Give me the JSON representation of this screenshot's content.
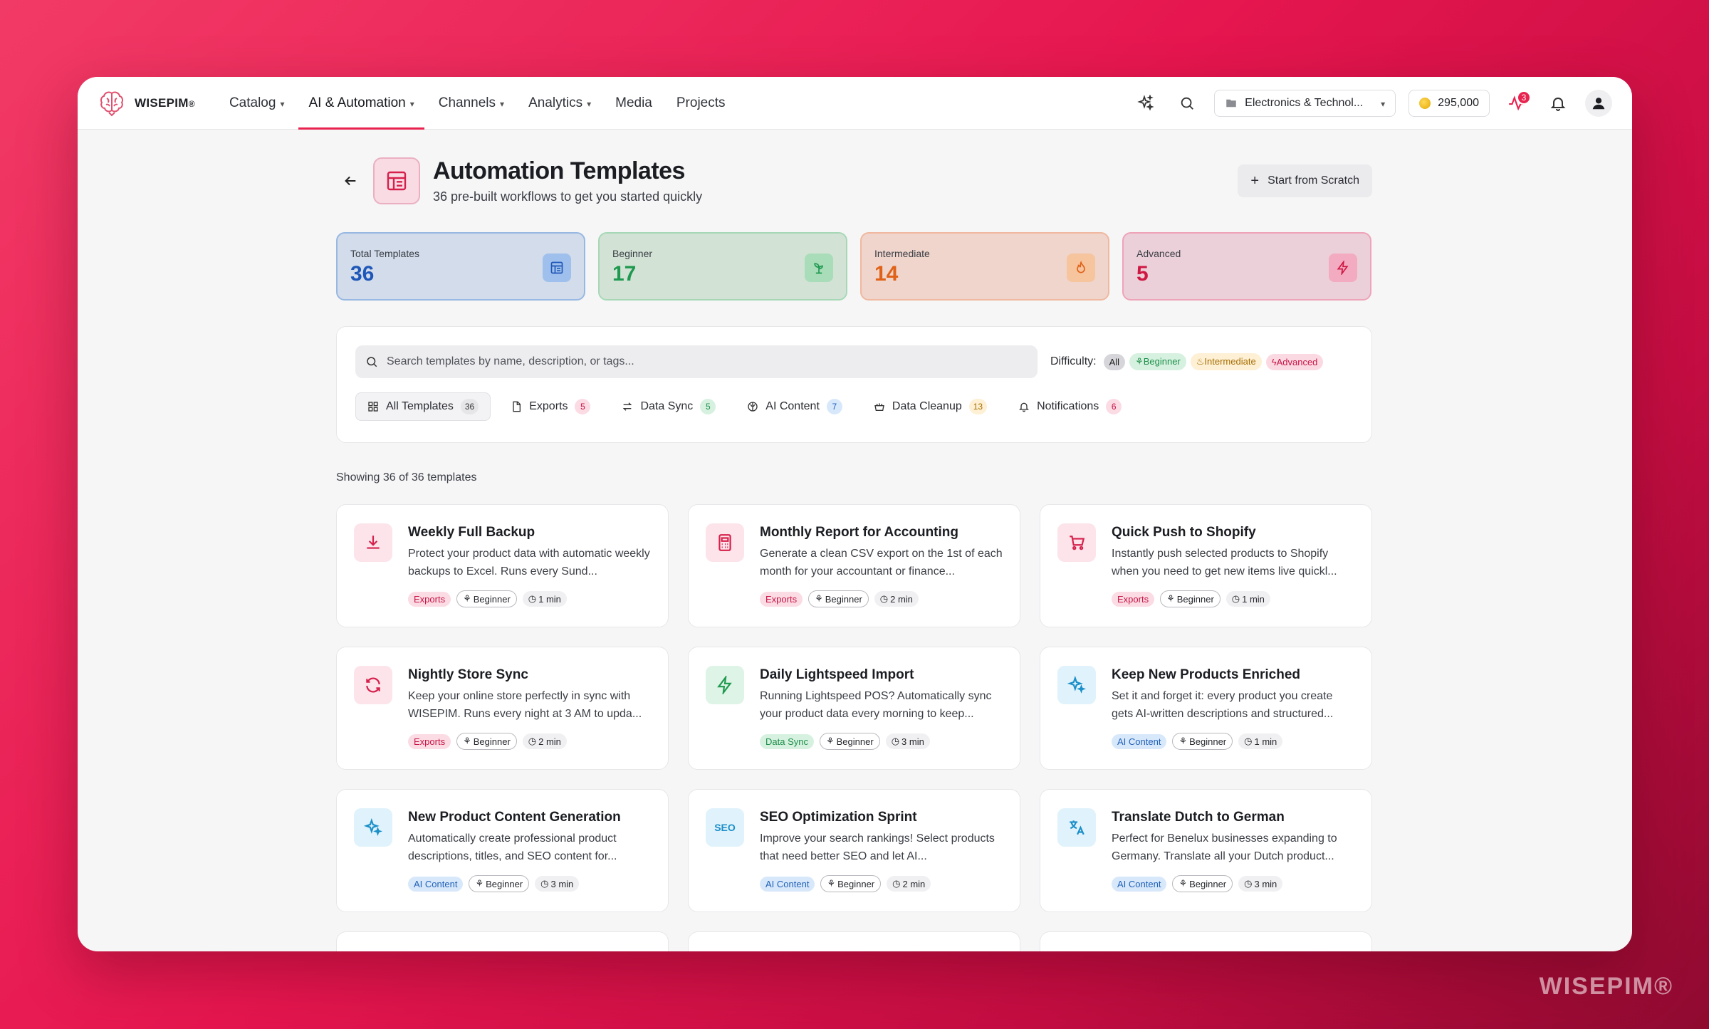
{
  "brand": {
    "name": "WISEPIM",
    "reg": "®",
    "watermark": "WISEPIM®"
  },
  "nav": [
    {
      "label": "Catalog",
      "dropdown": true,
      "active": false
    },
    {
      "label": "AI & Automation",
      "dropdown": true,
      "active": true
    },
    {
      "label": "Channels",
      "dropdown": true,
      "active": false
    },
    {
      "label": "Analytics",
      "dropdown": true,
      "active": false
    },
    {
      "label": "Media",
      "dropdown": false,
      "active": false
    },
    {
      "label": "Projects",
      "dropdown": false,
      "active": false
    }
  ],
  "topbar": {
    "workspace": "Electronics & Technol...",
    "credits": "295,000",
    "activity_badge": "3"
  },
  "page": {
    "title": "Automation Templates",
    "subtitle": "36 pre-built workflows to get you started quickly",
    "scratch_button": "Start from Scratch"
  },
  "stats": [
    {
      "label": "Total Templates",
      "value": "36",
      "icon": "template-icon"
    },
    {
      "label": "Beginner",
      "value": "17",
      "icon": "sprout-icon"
    },
    {
      "label": "Intermediate",
      "value": "14",
      "icon": "flame-icon"
    },
    {
      "label": "Advanced",
      "value": "5",
      "icon": "bolt-icon"
    }
  ],
  "filters": {
    "search_placeholder": "Search templates by name, description, or tags...",
    "difficulty_label": "Difficulty:",
    "difficulty_options": [
      "All",
      "Beginner",
      "Intermediate",
      "Advanced"
    ],
    "difficulty_selected": "All",
    "tabs": [
      {
        "label": "All Templates",
        "count": "36",
        "icon": "grid-icon"
      },
      {
        "label": "Exports",
        "count": "5",
        "icon": "file-icon"
      },
      {
        "label": "Data Sync",
        "count": "5",
        "icon": "arrows-icon"
      },
      {
        "label": "AI Content",
        "count": "7",
        "icon": "brain-icon"
      },
      {
        "label": "Data Cleanup",
        "count": "13",
        "icon": "brush-icon"
      },
      {
        "label": "Notifications",
        "count": "6",
        "icon": "bell-icon"
      }
    ]
  },
  "showing_text": "Showing 36 of 36 templates",
  "templates": [
    {
      "title": "Weekly Full Backup",
      "description": "Protect your product data with automatic weekly backups to Excel. Runs every Sund...",
      "category": "Exports",
      "level": "Beginner",
      "time": "1 min",
      "icon": "download-icon"
    },
    {
      "title": "Monthly Report for Accounting",
      "description": "Generate a clean CSV export on the 1st of each month for your accountant or finance...",
      "category": "Exports",
      "level": "Beginner",
      "time": "2 min",
      "icon": "calculator-icon"
    },
    {
      "title": "Quick Push to Shopify",
      "description": "Instantly push selected products to Shopify when you need to get new items live quickl...",
      "category": "Exports",
      "level": "Beginner",
      "time": "1 min",
      "icon": "cart-icon"
    },
    {
      "title": "Nightly Store Sync",
      "description": "Keep your online store perfectly in sync with WISEPIM. Runs every night at 3 AM to upda...",
      "category": "Exports",
      "level": "Beginner",
      "time": "2 min",
      "icon": "refresh-icon"
    },
    {
      "title": "Daily Lightspeed Import",
      "description": "Running Lightspeed POS? Automatically sync your product data every morning to keep...",
      "category": "Data Sync",
      "level": "Beginner",
      "time": "3 min",
      "icon": "bolt-icon"
    },
    {
      "title": "Keep New Products Enriched",
      "description": "Set it and forget it: every product you create gets AI-written descriptions and structured...",
      "category": "AI Content",
      "level": "Beginner",
      "time": "1 min",
      "icon": "sparkles-icon"
    },
    {
      "title": "New Product Content Generation",
      "description": "Automatically create professional product descriptions, titles, and SEO content for...",
      "category": "AI Content",
      "level": "Beginner",
      "time": "3 min",
      "icon": "sparkles-icon"
    },
    {
      "title": "SEO Optimization Sprint",
      "description": "Improve your search rankings! Select products that need better SEO and let AI...",
      "category": "AI Content",
      "level": "Beginner",
      "time": "2 min",
      "icon": "seo-icon",
      "icon_text": "SEO"
    },
    {
      "title": "Translate Dutch to German",
      "description": "Perfect for Benelux businesses expanding to Germany. Translate all your Dutch product...",
      "category": "AI Content",
      "level": "Beginner",
      "time": "3 min",
      "icon": "translate-icon"
    }
  ],
  "colors": {
    "accent": "#e8234f",
    "exports": "#c81545",
    "data_sync": "#1c8f49",
    "ai_content": "#2162b8"
  }
}
